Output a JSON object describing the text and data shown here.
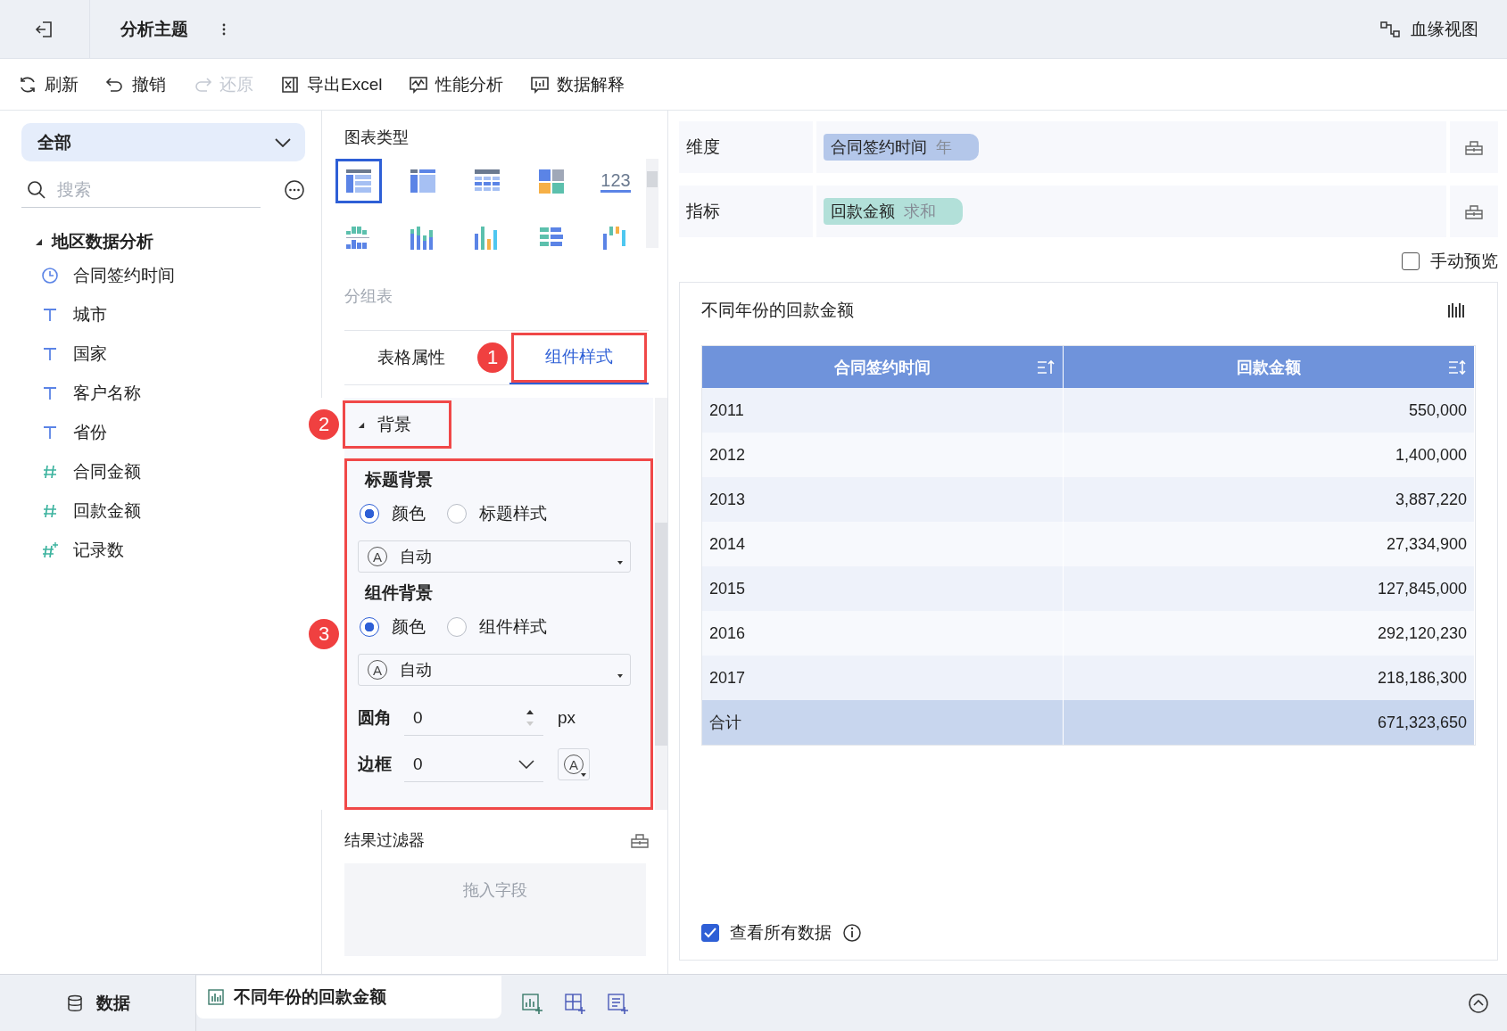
{
  "header": {
    "title": "分析主题",
    "lineage": "血缘视图"
  },
  "toolbar": [
    {
      "kind": "refresh",
      "label": "刷新",
      "disabled": false
    },
    {
      "kind": "undo",
      "label": "撤销",
      "disabled": false
    },
    {
      "kind": "redo",
      "label": "还原",
      "disabled": true
    },
    {
      "kind": "excel",
      "label": "导出Excel",
      "disabled": false
    },
    {
      "kind": "performance",
      "label": "性能分析",
      "disabled": false
    },
    {
      "kind": "explain",
      "label": "数据解释",
      "disabled": false
    }
  ],
  "data_panel": {
    "scope": "全部",
    "search": {
      "placeholder": "搜索"
    },
    "tree": {
      "label": "地区数据分析",
      "expanded": true,
      "children": [
        {
          "kind": "date",
          "label": "合同签约时间"
        },
        {
          "kind": "text",
          "label": "城市"
        },
        {
          "kind": "text",
          "label": "国家"
        },
        {
          "kind": "text",
          "label": "客户名称"
        },
        {
          "kind": "text",
          "label": "省份"
        },
        {
          "kind": "number",
          "label": "合同金额"
        },
        {
          "kind": "number",
          "label": "回款金额"
        },
        {
          "kind": "count",
          "label": "记录数"
        }
      ]
    }
  },
  "chart_panel": {
    "title": "图表类型",
    "chart_types": [
      {
        "kind": "group-table",
        "selected": true
      },
      {
        "kind": "cross-table",
        "selected": false
      },
      {
        "kind": "detail-table",
        "selected": false
      },
      {
        "kind": "kpi",
        "selected": false
      },
      {
        "kind": "number",
        "label": "123",
        "selected": false
      },
      {
        "kind": "grouped-bars",
        "selected": false
      },
      {
        "kind": "stacked-bars",
        "selected": false
      },
      {
        "kind": "bars",
        "selected": false
      },
      {
        "kind": "hbars",
        "selected": false
      },
      {
        "kind": "waterfall",
        "selected": false
      }
    ],
    "chart_name": "分组表",
    "tabs": [
      {
        "label": "表格属性",
        "selected": false
      },
      {
        "label": "组件样式",
        "selected": true,
        "annotation": "1"
      }
    ],
    "section": {
      "label": "背景",
      "expanded": true,
      "annotation": "2"
    },
    "settings": {
      "annotation": "3",
      "groups": [
        {
          "title": "标题背景",
          "options": [
            {
              "label": "颜色",
              "selected": true
            },
            {
              "label": "标题样式",
              "selected": false
            }
          ],
          "select": {
            "glyph": "A",
            "value": "自动"
          }
        },
        {
          "title": "组件背景",
          "options": [
            {
              "label": "颜色",
              "selected": true
            },
            {
              "label": "组件样式",
              "selected": false
            }
          ],
          "select": {
            "glyph": "A",
            "value": "自动"
          }
        }
      ],
      "radius": {
        "label": "圆角",
        "value": "0",
        "unit": "px"
      },
      "border": {
        "label": "边框",
        "value": "0",
        "color_glyph": "A"
      }
    },
    "filter": {
      "title": "结果过滤器",
      "placeholder": "拖入字段"
    }
  },
  "shelves": [
    {
      "label": "维度",
      "chips": [
        {
          "name": "合同签约时间",
          "agg": "年",
          "color": "#b4c7ea"
        }
      ]
    },
    {
      "label": "指标",
      "chips": [
        {
          "name": "回款金额",
          "agg": "求和",
          "color": "#b2e0d9"
        }
      ]
    }
  ],
  "manual_preview": {
    "label": "手动预览",
    "checked": false
  },
  "widget": {
    "title": "不同年份的回款金额",
    "columns": [
      "合同签约时间",
      "回款金额"
    ],
    "rows": [
      [
        "2011",
        "550,000"
      ],
      [
        "2012",
        "1,400,000"
      ],
      [
        "2013",
        "3,887,220"
      ],
      [
        "2014",
        "27,334,900"
      ],
      [
        "2015",
        "127,845,000"
      ],
      [
        "2016",
        "292,120,230"
      ],
      [
        "2017",
        "218,186,300"
      ]
    ],
    "total": [
      "合计",
      "671,323,650"
    ],
    "view_all": {
      "label": "查看所有数据",
      "checked": true
    }
  },
  "bottom_bar": {
    "data_tab": "数据",
    "sheets": [
      {
        "label": "不同年份的回款金额",
        "selected": true
      }
    ]
  }
}
